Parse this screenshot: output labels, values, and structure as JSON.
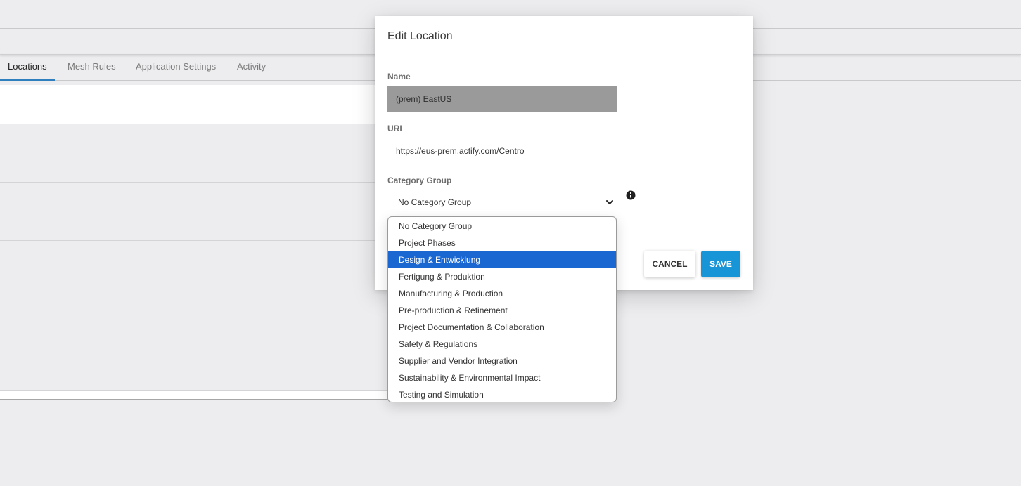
{
  "tabs": [
    {
      "label": "Locations",
      "active": true
    },
    {
      "label": "Mesh Rules",
      "active": false
    },
    {
      "label": "Application Settings",
      "active": false
    },
    {
      "label": "Activity",
      "active": false
    }
  ],
  "dialog": {
    "title": "Edit Location",
    "name_label": "Name",
    "name_value": "(prem) EastUS",
    "uri_label": "URI",
    "uri_value": "https://eus-prem.actify.com/Centro",
    "category_label": "Category Group",
    "category_selected": "No Category Group",
    "cancel_label": "CANCEL",
    "save_label": "SAVE"
  },
  "dropdown": {
    "options": [
      "No Category Group",
      "Project Phases",
      "Design & Entwicklung",
      "Fertigung & Produktion",
      "Manufacturing & Production",
      "Pre-production & Refinement",
      "Project Documentation & Collaboration",
      "Safety & Regulations",
      "Supplier and Vendor Integration",
      "Sustainability & Environmental Impact",
      "Testing and Simulation"
    ],
    "highlighted": "Design & Entwicklung"
  },
  "colors": {
    "accent": "#1795d6",
    "highlight": "#1a67d2",
    "tab_underline": "#2f7fbf"
  },
  "icons": {
    "select": "chevron-down-icon",
    "info": "info-icon"
  }
}
